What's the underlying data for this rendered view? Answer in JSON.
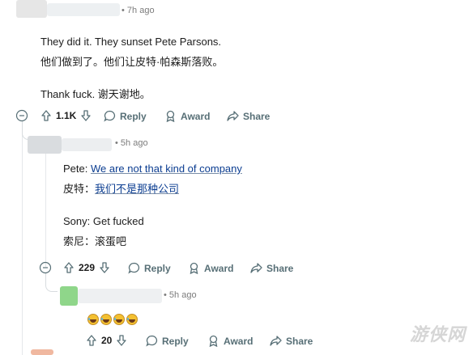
{
  "comment1": {
    "time": "7h ago",
    "lines": [
      "They did it. They sunset Pete Parsons.",
      "他们做到了。他们让皮特·帕森斯落败。",
      "Thank fuck.  谢天谢地。"
    ],
    "votes": "1.1K",
    "reply": "Reply",
    "award": "Award",
    "share": "Share"
  },
  "comment2": {
    "time": "5h ago",
    "line1_prefix": "Pete: ",
    "line1_link": "We are not that kind of company",
    "line2_prefix": "皮特：",
    "line2_link": "我们不是那种公司",
    "line3": "Sony: Get fucked",
    "line4": "索尼：滚蛋吧",
    "votes": "229",
    "reply": "Reply",
    "award": "Award",
    "share": "Share"
  },
  "comment3": {
    "time": "5h ago",
    "emoji_count": 4,
    "votes": "20",
    "reply": "Reply",
    "award": "Award",
    "share": "Share"
  },
  "watermark": "游侠网",
  "colors": {
    "upvote": "#576f76",
    "link": "#0b3d91",
    "avatar_green": "#8fd68a"
  }
}
